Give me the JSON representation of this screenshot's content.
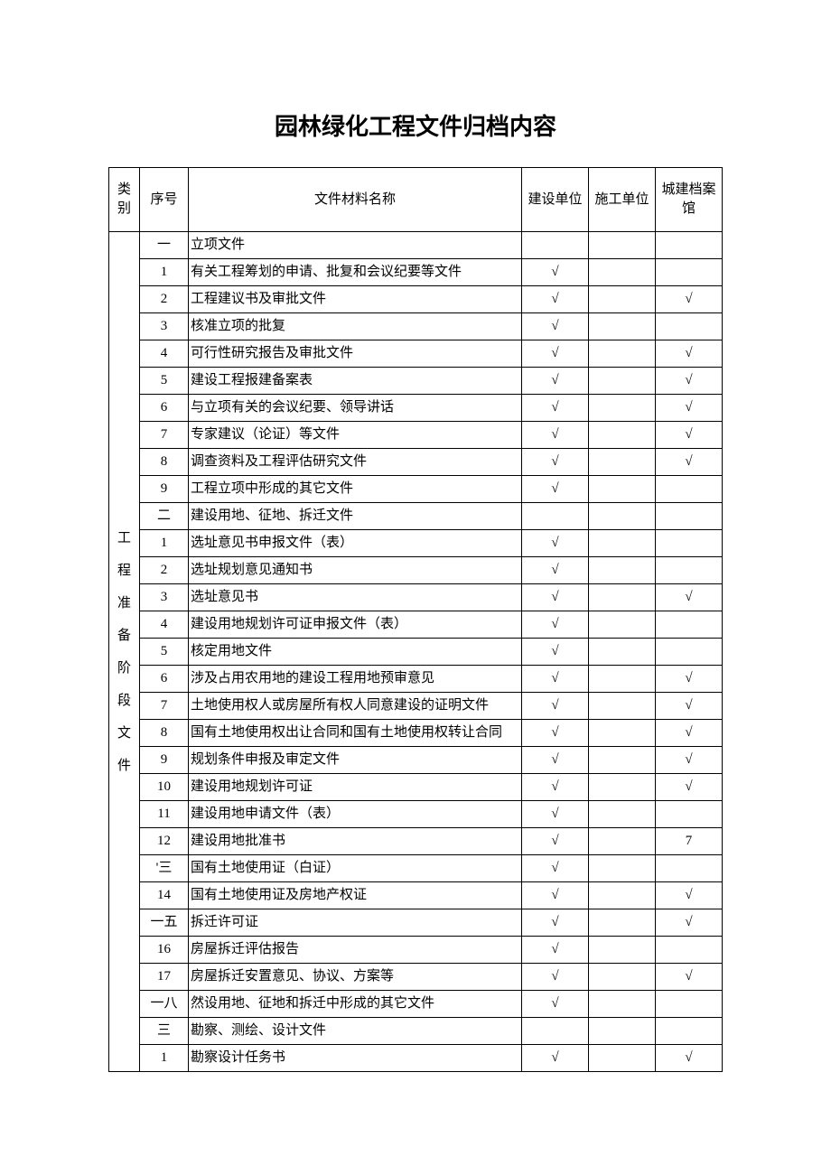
{
  "title": "园林绿化工程文件归档内容",
  "header": {
    "category": "类别",
    "seq": "序号",
    "name": "文件材料名称",
    "c1": "建设单位",
    "c2": "施工单位",
    "c3": "城建档案馆"
  },
  "category_label": "工程准备阶段文件",
  "rows": [
    {
      "seq": "一",
      "name": "立项文件",
      "c1": "",
      "c2": "",
      "c3": ""
    },
    {
      "seq": "1",
      "name": "有关工程筹划的申请、批复和会议纪要等文件",
      "c1": "√",
      "c2": "",
      "c3": ""
    },
    {
      "seq": "2",
      "name": "工程建议书及审批文件",
      "c1": "√",
      "c2": "",
      "c3": "√"
    },
    {
      "seq": "3",
      "name": "核准立项的批复",
      "c1": "√",
      "c2": "",
      "c3": ""
    },
    {
      "seq": "4",
      "name": "可行性研究报告及审批文件",
      "c1": "√",
      "c2": "",
      "c3": "√"
    },
    {
      "seq": "5",
      "name": "建设工程报建备案表",
      "c1": "√",
      "c2": "",
      "c3": "√"
    },
    {
      "seq": "6",
      "name": "与立项有关的会议纪要、领导讲话",
      "c1": "√",
      "c2": "",
      "c3": "√"
    },
    {
      "seq": "7",
      "name": "专家建议（论证）等文件",
      "c1": "√",
      "c2": "",
      "c3": "√"
    },
    {
      "seq": "8",
      "name": "调查资料及工程评估研究文件",
      "c1": "√",
      "c2": "",
      "c3": "√"
    },
    {
      "seq": "9",
      "name": "工程立项中形成的其它文件",
      "c1": "√",
      "c2": "",
      "c3": ""
    },
    {
      "seq": "二",
      "name": "建设用地、征地、拆迁文件",
      "c1": "",
      "c2": "",
      "c3": ""
    },
    {
      "seq": "1",
      "name": "选址意见书申报文件（表）",
      "c1": "√",
      "c2": "",
      "c3": ""
    },
    {
      "seq": "2",
      "name": "选址规划意见通知书",
      "c1": "√",
      "c2": "",
      "c3": ""
    },
    {
      "seq": "3",
      "name": "选址意见书",
      "c1": "√",
      "c2": "",
      "c3": "√"
    },
    {
      "seq": "4",
      "name": "建设用地规划许可证申报文件（表）",
      "c1": "√",
      "c2": "",
      "c3": ""
    },
    {
      "seq": "5",
      "name": "核定用地文件",
      "c1": "√",
      "c2": "",
      "c3": ""
    },
    {
      "seq": "6",
      "name": "涉及占用农用地的建设工程用地预审意见",
      "c1": "√",
      "c2": "",
      "c3": "√"
    },
    {
      "seq": "7",
      "name": "土地使用权人或房屋所有权人同意建设的证明文件",
      "c1": "√",
      "c2": "",
      "c3": "√"
    },
    {
      "seq": "8",
      "name": "国有土地使用权出让合同和国有土地使用权转让合同",
      "c1": "√",
      "c2": "",
      "c3": "√"
    },
    {
      "seq": "9",
      "name": "规划条件申报及审定文件",
      "c1": "√",
      "c2": "",
      "c3": "√"
    },
    {
      "seq": "10",
      "name": "建设用地规划许可证",
      "c1": "√",
      "c2": "",
      "c3": "√"
    },
    {
      "seq": "11",
      "name": "建设用地申请文件（表）",
      "c1": "√",
      "c2": "",
      "c3": ""
    },
    {
      "seq": "12",
      "name": "建设用地批准书",
      "c1": "√",
      "c2": "",
      "c3": "7"
    },
    {
      "seq": "'三",
      "name": "国有土地使用证（白证）",
      "c1": "√",
      "c2": "",
      "c3": ""
    },
    {
      "seq": "14",
      "name": "国有土地使用证及房地产权证",
      "c1": "√",
      "c2": "",
      "c3": "√"
    },
    {
      "seq": "一五",
      "name": "拆迁许可证",
      "c1": "√",
      "c2": "",
      "c3": "√"
    },
    {
      "seq": "16",
      "name": "房屋拆迁评估报告",
      "c1": "√",
      "c2": "",
      "c3": ""
    },
    {
      "seq": "17",
      "name": "房屋拆迁安置意见、协议、方案等",
      "c1": "√",
      "c2": "",
      "c3": "√"
    },
    {
      "seq": "一八",
      "name": "然设用地、征地和拆迁中形成的其它文件",
      "c1": "√",
      "c2": "",
      "c3": ""
    },
    {
      "seq": "三",
      "name": "勘察、测绘、设计文件",
      "c1": "",
      "c2": "",
      "c3": ""
    },
    {
      "seq": "1",
      "name": "勘察设计任务书",
      "c1": "√",
      "c2": "",
      "c3": "√"
    }
  ]
}
